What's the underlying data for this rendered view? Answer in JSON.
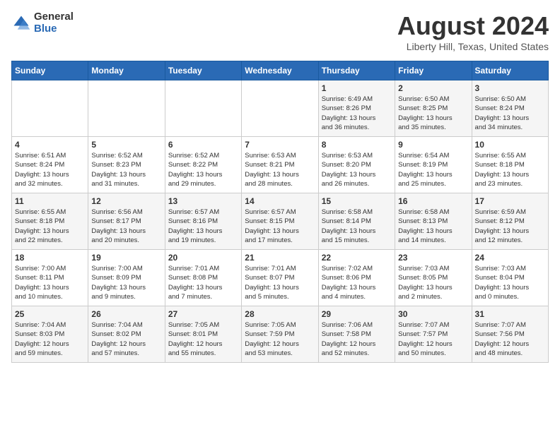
{
  "logo": {
    "general": "General",
    "blue": "Blue"
  },
  "calendar": {
    "title": "August 2024",
    "subtitle": "Liberty Hill, Texas, United States",
    "headers": [
      "Sunday",
      "Monday",
      "Tuesday",
      "Wednesday",
      "Thursday",
      "Friday",
      "Saturday"
    ],
    "weeks": [
      [
        {
          "day": "",
          "info": ""
        },
        {
          "day": "",
          "info": ""
        },
        {
          "day": "",
          "info": ""
        },
        {
          "day": "",
          "info": ""
        },
        {
          "day": "1",
          "info": "Sunrise: 6:49 AM\nSunset: 8:26 PM\nDaylight: 13 hours\nand 36 minutes."
        },
        {
          "day": "2",
          "info": "Sunrise: 6:50 AM\nSunset: 8:25 PM\nDaylight: 13 hours\nand 35 minutes."
        },
        {
          "day": "3",
          "info": "Sunrise: 6:50 AM\nSunset: 8:24 PM\nDaylight: 13 hours\nand 34 minutes."
        }
      ],
      [
        {
          "day": "4",
          "info": "Sunrise: 6:51 AM\nSunset: 8:24 PM\nDaylight: 13 hours\nand 32 minutes."
        },
        {
          "day": "5",
          "info": "Sunrise: 6:52 AM\nSunset: 8:23 PM\nDaylight: 13 hours\nand 31 minutes."
        },
        {
          "day": "6",
          "info": "Sunrise: 6:52 AM\nSunset: 8:22 PM\nDaylight: 13 hours\nand 29 minutes."
        },
        {
          "day": "7",
          "info": "Sunrise: 6:53 AM\nSunset: 8:21 PM\nDaylight: 13 hours\nand 28 minutes."
        },
        {
          "day": "8",
          "info": "Sunrise: 6:53 AM\nSunset: 8:20 PM\nDaylight: 13 hours\nand 26 minutes."
        },
        {
          "day": "9",
          "info": "Sunrise: 6:54 AM\nSunset: 8:19 PM\nDaylight: 13 hours\nand 25 minutes."
        },
        {
          "day": "10",
          "info": "Sunrise: 6:55 AM\nSunset: 8:18 PM\nDaylight: 13 hours\nand 23 minutes."
        }
      ],
      [
        {
          "day": "11",
          "info": "Sunrise: 6:55 AM\nSunset: 8:18 PM\nDaylight: 13 hours\nand 22 minutes."
        },
        {
          "day": "12",
          "info": "Sunrise: 6:56 AM\nSunset: 8:17 PM\nDaylight: 13 hours\nand 20 minutes."
        },
        {
          "day": "13",
          "info": "Sunrise: 6:57 AM\nSunset: 8:16 PM\nDaylight: 13 hours\nand 19 minutes."
        },
        {
          "day": "14",
          "info": "Sunrise: 6:57 AM\nSunset: 8:15 PM\nDaylight: 13 hours\nand 17 minutes."
        },
        {
          "day": "15",
          "info": "Sunrise: 6:58 AM\nSunset: 8:14 PM\nDaylight: 13 hours\nand 15 minutes."
        },
        {
          "day": "16",
          "info": "Sunrise: 6:58 AM\nSunset: 8:13 PM\nDaylight: 13 hours\nand 14 minutes."
        },
        {
          "day": "17",
          "info": "Sunrise: 6:59 AM\nSunset: 8:12 PM\nDaylight: 13 hours\nand 12 minutes."
        }
      ],
      [
        {
          "day": "18",
          "info": "Sunrise: 7:00 AM\nSunset: 8:11 PM\nDaylight: 13 hours\nand 10 minutes."
        },
        {
          "day": "19",
          "info": "Sunrise: 7:00 AM\nSunset: 8:09 PM\nDaylight: 13 hours\nand 9 minutes."
        },
        {
          "day": "20",
          "info": "Sunrise: 7:01 AM\nSunset: 8:08 PM\nDaylight: 13 hours\nand 7 minutes."
        },
        {
          "day": "21",
          "info": "Sunrise: 7:01 AM\nSunset: 8:07 PM\nDaylight: 13 hours\nand 5 minutes."
        },
        {
          "day": "22",
          "info": "Sunrise: 7:02 AM\nSunset: 8:06 PM\nDaylight: 13 hours\nand 4 minutes."
        },
        {
          "day": "23",
          "info": "Sunrise: 7:03 AM\nSunset: 8:05 PM\nDaylight: 13 hours\nand 2 minutes."
        },
        {
          "day": "24",
          "info": "Sunrise: 7:03 AM\nSunset: 8:04 PM\nDaylight: 13 hours\nand 0 minutes."
        }
      ],
      [
        {
          "day": "25",
          "info": "Sunrise: 7:04 AM\nSunset: 8:03 PM\nDaylight: 12 hours\nand 59 minutes."
        },
        {
          "day": "26",
          "info": "Sunrise: 7:04 AM\nSunset: 8:02 PM\nDaylight: 12 hours\nand 57 minutes."
        },
        {
          "day": "27",
          "info": "Sunrise: 7:05 AM\nSunset: 8:01 PM\nDaylight: 12 hours\nand 55 minutes."
        },
        {
          "day": "28",
          "info": "Sunrise: 7:05 AM\nSunset: 7:59 PM\nDaylight: 12 hours\nand 53 minutes."
        },
        {
          "day": "29",
          "info": "Sunrise: 7:06 AM\nSunset: 7:58 PM\nDaylight: 12 hours\nand 52 minutes."
        },
        {
          "day": "30",
          "info": "Sunrise: 7:07 AM\nSunset: 7:57 PM\nDaylight: 12 hours\nand 50 minutes."
        },
        {
          "day": "31",
          "info": "Sunrise: 7:07 AM\nSunset: 7:56 PM\nDaylight: 12 hours\nand 48 minutes."
        }
      ]
    ]
  }
}
